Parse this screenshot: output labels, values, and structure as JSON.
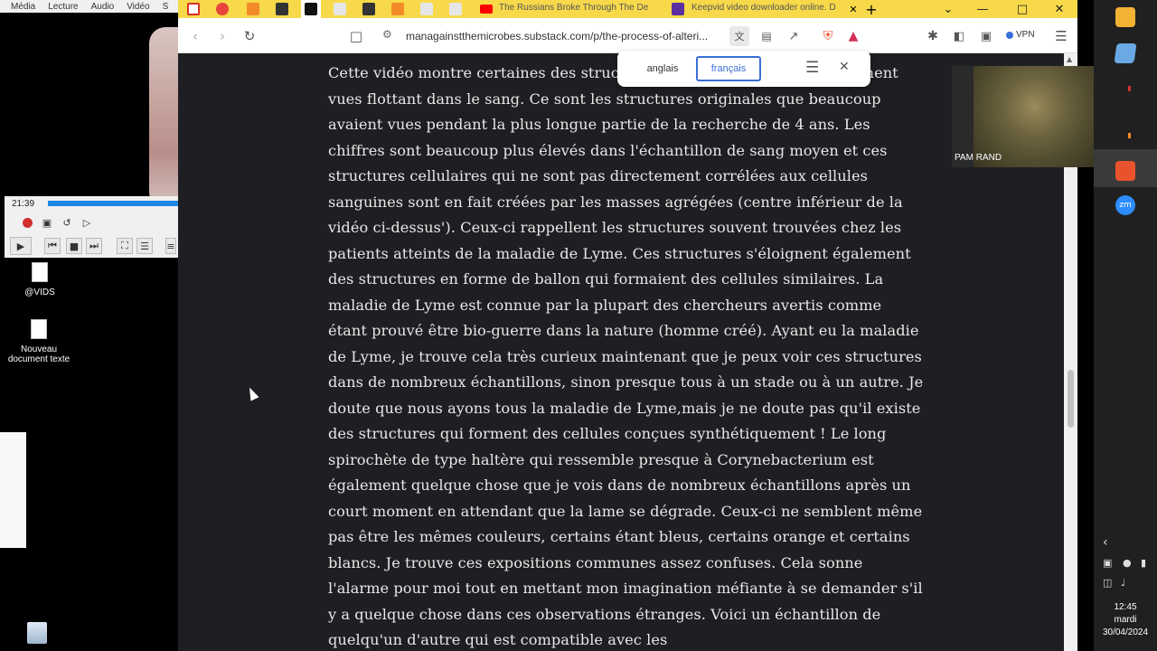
{
  "vlc": {
    "menu": [
      "Média",
      "Lecture",
      "Audio",
      "Vidéo",
      "S"
    ],
    "time": "21:39",
    "progress": 0.99
  },
  "desktop": {
    "icons": [
      {
        "label": "@VIDS"
      },
      {
        "label": "Nouveau document texte"
      }
    ]
  },
  "browser": {
    "tabs": [
      {
        "title": "The Russians Broke Through The De"
      },
      {
        "title": "Keepvid video downloader online. D"
      }
    ],
    "url": "managainstthemicrobes.substack.com/p/the-process-of-alteri...",
    "vpn_label": "VPN"
  },
  "translate": {
    "source": "anglais",
    "target": "français"
  },
  "article": {
    "text": "Cette vidéo montre certaines des structures étranges qui sont fréquemment vues flottant dans le sang. Ce sont les structures originales que beaucoup avaient vues pendant la plus longue partie de la recherche de 4 ans. Les chiffres sont beaucoup plus élevés dans l'échantillon de sang moyen et ces structures cellulaires qui ne sont pas directement corrélées aux cellules sanguines sont en fait créées par les masses agrégées (centre inférieur de la vidéo ci-dessus'). Ceux-ci rappellent les structures souvent trouvées chez les patients atteints de la maladie de Lyme. Ces structures s'éloignent également des structures en forme de ballon qui formaient des cellules similaires. La maladie de Lyme est connue par la plupart des chercheurs avertis comme étant prouvé être bio-guerre dans la nature (homme créé). Ayant eu la maladie de Lyme, je trouve cela très curieux maintenant que je peux voir ces structures dans de nombreux échantillons, sinon presque tous à un stade ou à un autre. Je doute que nous ayons tous la maladie de Lyme,mais je ne doute pas qu'il existe des structures qui forment des cellules conçues synthétiquement ! Le long spirochète de type haltère qui ressemble presque à Corynebacterium est également quelque chose que je vois dans de nombreux échantillons après un court moment en attendant que la lame se dégrade. Ceux-ci ne semblent même pas être les mêmes couleurs, certains étant bleus, certains orange et certains blancs. Je trouve ces expositions communes assez confuses. Cela sonne l'alarme pour moi tout en mettant mon imagination méfiante à se demander s'il y a quelque chose dans ces observations étranges. Voici un échantillon de quelqu'un d'autre qui est compatible avec les"
  },
  "webcam": {
    "name": "PAM RAND"
  },
  "taskbar": {
    "time": "12:45",
    "day": "mardi",
    "date": "30/04/2024"
  },
  "colors": {
    "tabbar": "#f7d94a",
    "page_bg": "#1e1f22",
    "article_text": "#e8e8e8",
    "accent": "#3b6fd8"
  }
}
